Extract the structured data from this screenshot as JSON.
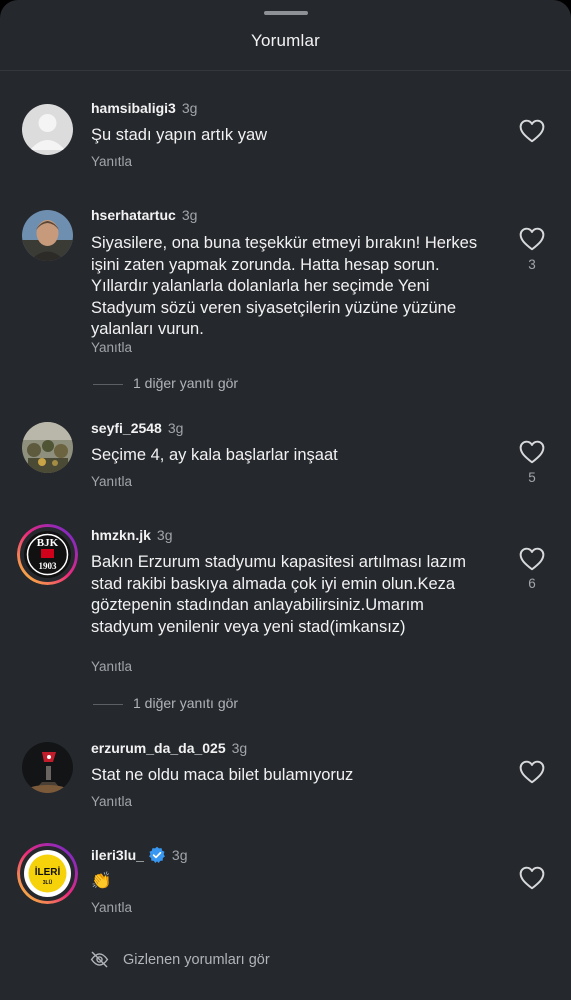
{
  "header": {
    "title": "Yorumlar"
  },
  "comments": [
    {
      "username": "hamsibaligi3",
      "time": "3g",
      "text": "Şu stadı yapın artık yaw",
      "reply_label": "Yanıtla",
      "likes": ""
    },
    {
      "username": "hserhatartuc",
      "time": "3g",
      "text": "Siyasilere, ona buna teşekkür etmeyi bırakın! Herkes işini zaten yapmak zorunda. Hatta hesap sorun. Yıllardır yalanlarla dolanlarla her seçimde Yeni Stadyum sözü veren siyasetçilerin yüzüne yüzüne yalanları vurun.",
      "reply_label": "Yanıtla",
      "likes": "3",
      "more_replies": "1 diğer yanıtı gör"
    },
    {
      "username": "seyfi_2548",
      "time": "3g",
      "text": "Seçime 4, ay kala başlarlar inşaat",
      "reply_label": "Yanıtla",
      "likes": "5"
    },
    {
      "username": "hmzkn.jk",
      "time": "3g",
      "text": "Bakın Erzurum stadyumu kapasitesi artılması lazım stad rakibi baskıya almada çok iyi emin olun.Keza göztepenin stadından anlayabilirsiniz.Umarım stadyum yenilenir veya yeni stad(imkansız)",
      "reply_label": "Yanıtla",
      "likes": "6",
      "more_replies": "1 diğer yanıtı gör",
      "avatar_text": {
        "letters": "BJK",
        "year": "1903"
      }
    },
    {
      "username": "erzurum_da_da_025",
      "time": "3g",
      "text": "Stat ne oldu maca bilet bulamıyoruz",
      "reply_label": "Yanıtla",
      "likes": ""
    },
    {
      "username": "ileri3lu_",
      "time": "3g",
      "text": "👏",
      "reply_label": "Yanıtla",
      "likes": "",
      "verified": true,
      "avatar_text": {
        "main": "İLERİ",
        "sub": "3LÜ"
      }
    }
  ],
  "footer": {
    "hidden_comments": "Gizlenen yorumları gör"
  },
  "colors": {
    "background": "#25282d",
    "text": "#f2f2f2",
    "muted": "#a2a5aa",
    "verified": "#3897f0"
  }
}
